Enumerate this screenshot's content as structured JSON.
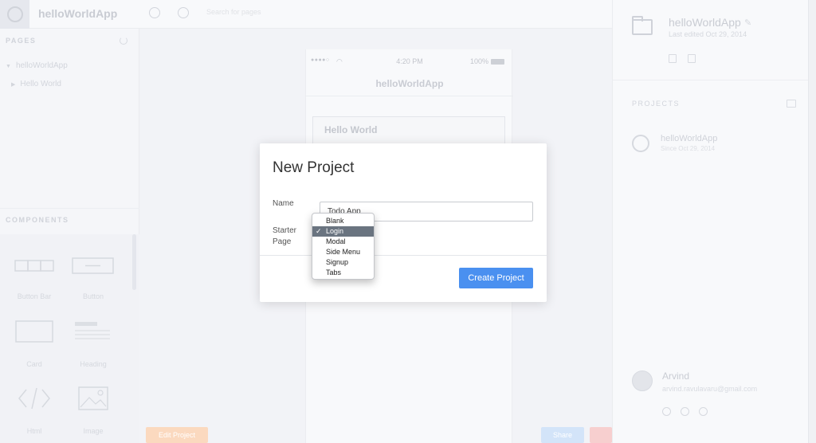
{
  "app": {
    "title": "helloWorldApp",
    "search_placeholder": "Search for pages"
  },
  "sidebar": {
    "pages_label": "PAGES",
    "tree": [
      {
        "label": "helloWorldApp"
      },
      {
        "label": "Hello World"
      }
    ],
    "components_label": "COMPONENTS",
    "components": [
      {
        "label": "Button Bar",
        "icon": "button-bar-icon"
      },
      {
        "label": "Button",
        "icon": "button-icon"
      },
      {
        "label": "Card",
        "icon": "card-icon"
      },
      {
        "label": "Heading",
        "icon": "heading-icon"
      },
      {
        "label": "Html",
        "icon": "code-icon"
      },
      {
        "label": "Image",
        "icon": "image-icon"
      }
    ]
  },
  "phone": {
    "carrier": "●●●●○",
    "time": "4:20 PM",
    "battery": "100%",
    "nav_title": "helloWorldApp",
    "card_title": "Hello World"
  },
  "canvas": {
    "bottom_left_btn": "Edit Project",
    "bottom_right_btn": "Share",
    "colors": {
      "orange": "#f7a86b",
      "blue": "#9ec5f5",
      "red": "#f08a8a"
    }
  },
  "right_panel": {
    "project_name": "helloWorldApp",
    "project_meta": "Last edited Oct 29, 2014",
    "projects_label": "PROJECTS",
    "projects": [
      {
        "name": "helloWorldApp",
        "date": "Since Oct 29, 2014"
      }
    ],
    "user": {
      "name": "Arvind",
      "email": "arvind.ravulavaru@gmail.com"
    }
  },
  "modal": {
    "title": "New Project",
    "name_label": "Name",
    "name_value": "Todo App",
    "starter_label_1": "Starter",
    "starter_label_2": "Page",
    "create_label": "Create Project",
    "accent_color": "#4a90f0"
  },
  "dropdown": {
    "check": "✓",
    "selected_value": "Login",
    "options": [
      "Blank",
      "Login",
      "Modal",
      "Side Menu",
      "Signup",
      "Tabs"
    ]
  }
}
